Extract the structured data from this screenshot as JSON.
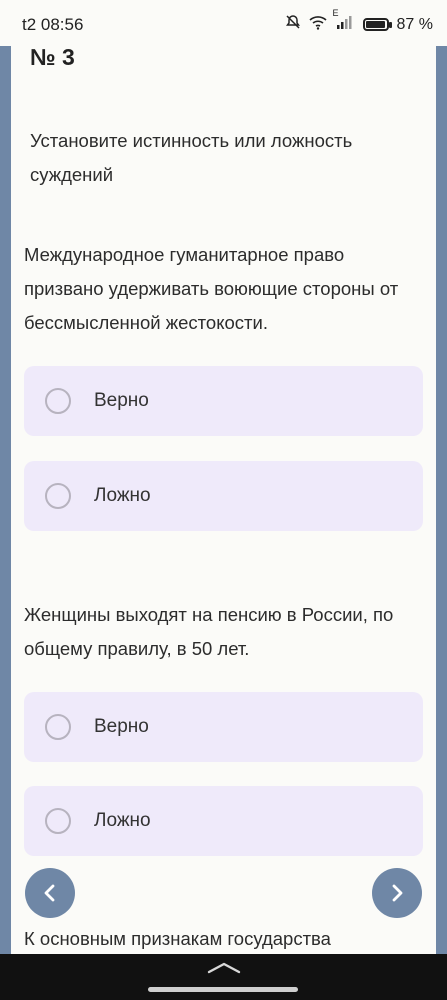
{
  "status_bar": {
    "time": "t2 08:56",
    "network_label": "E",
    "battery_percent": "87 %",
    "battery_level": 0.87,
    "icons": [
      "bell-off-icon",
      "wifi-icon",
      "signal-icon",
      "battery-icon"
    ]
  },
  "question": {
    "number": "№ 3",
    "instruction": "Установите истинность или ложность суждений"
  },
  "statements": [
    {
      "text": "Международное гуманитарное право призвано удерживать воюющие стороны от бессмысленной жестокости.",
      "options": [
        "Верно",
        "Ложно"
      ]
    },
    {
      "text": "Женщины выходят на пенсию в России, по общему правилу, в 50 лет.",
      "options": [
        "Верно",
        "Ложно"
      ]
    }
  ],
  "next_statement_partial": "К основным признакам государства",
  "colors": {
    "accent": "#6f87a6",
    "option_bg": "#efeafa",
    "card_bg": "#fbfbf8"
  }
}
